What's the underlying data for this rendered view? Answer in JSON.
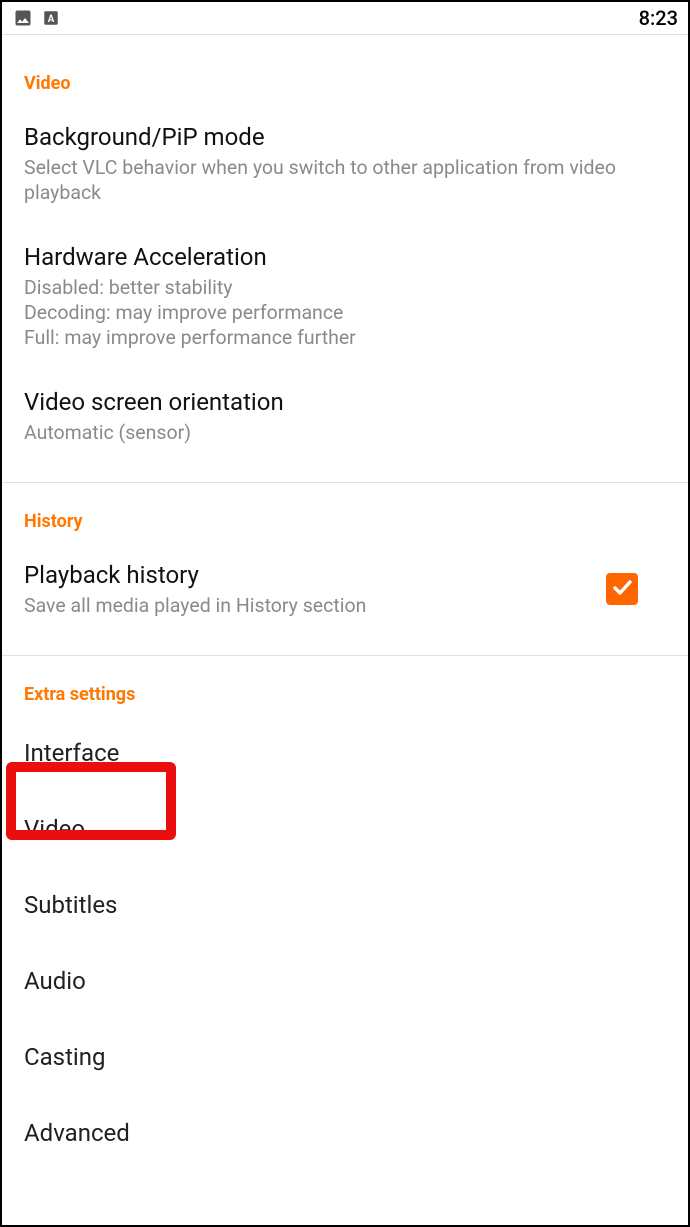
{
  "statusBar": {
    "time": "8:23"
  },
  "sections": {
    "video": {
      "header": "Video",
      "items": {
        "bgPip": {
          "title": "Background/PiP mode",
          "desc": "Select VLC behavior when you switch to other application from video playback"
        },
        "hwAccel": {
          "title": "Hardware Acceleration",
          "desc": "Disabled: better stability\nDecoding: may improve performance\nFull: may improve performance further"
        },
        "orientation": {
          "title": "Video screen orientation",
          "desc": "Automatic (sensor)"
        }
      }
    },
    "history": {
      "header": "History",
      "items": {
        "playback": {
          "title": "Playback history",
          "desc": "Save all media played in History section",
          "checked": true
        }
      }
    },
    "extra": {
      "header": "Extra settings",
      "items": {
        "interface": "Interface",
        "video": "Video",
        "subtitles": "Subtitles",
        "audio": "Audio",
        "casting": "Casting",
        "advanced": "Advanced"
      }
    }
  }
}
